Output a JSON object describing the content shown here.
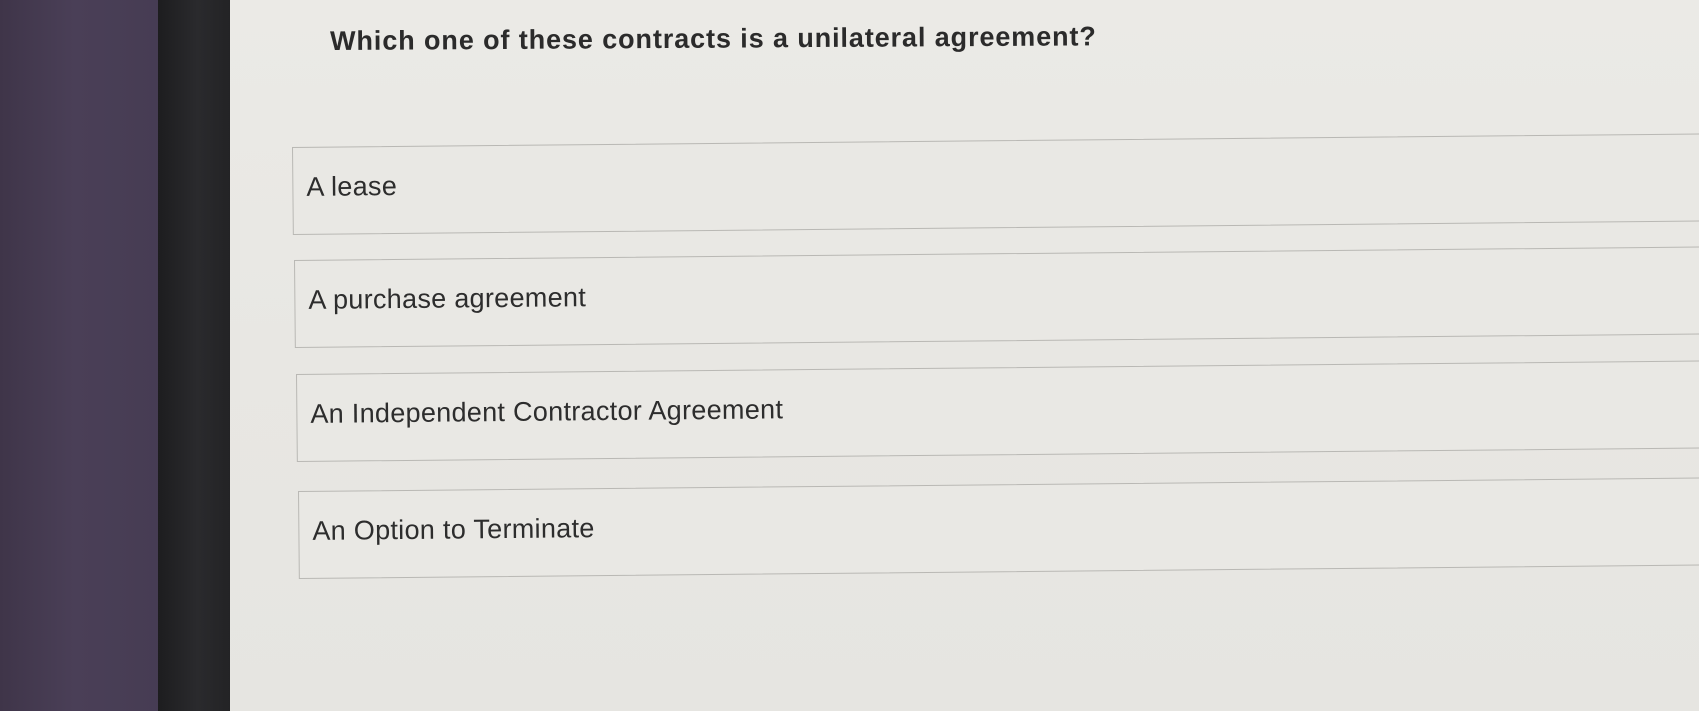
{
  "question": {
    "text": "Which one of these contracts is a unilateral agreement?"
  },
  "options": [
    {
      "label": "A lease"
    },
    {
      "label": "A purchase agreement"
    },
    {
      "label": "An Independent Contractor Agreement"
    },
    {
      "label": "An Option to Terminate"
    }
  ],
  "colors": {
    "page_background": "#e9e8e4",
    "option_border": "#b9b8b4",
    "text": "#2b2b2b",
    "left_strip": "#463c53",
    "bezel": "#232325"
  }
}
